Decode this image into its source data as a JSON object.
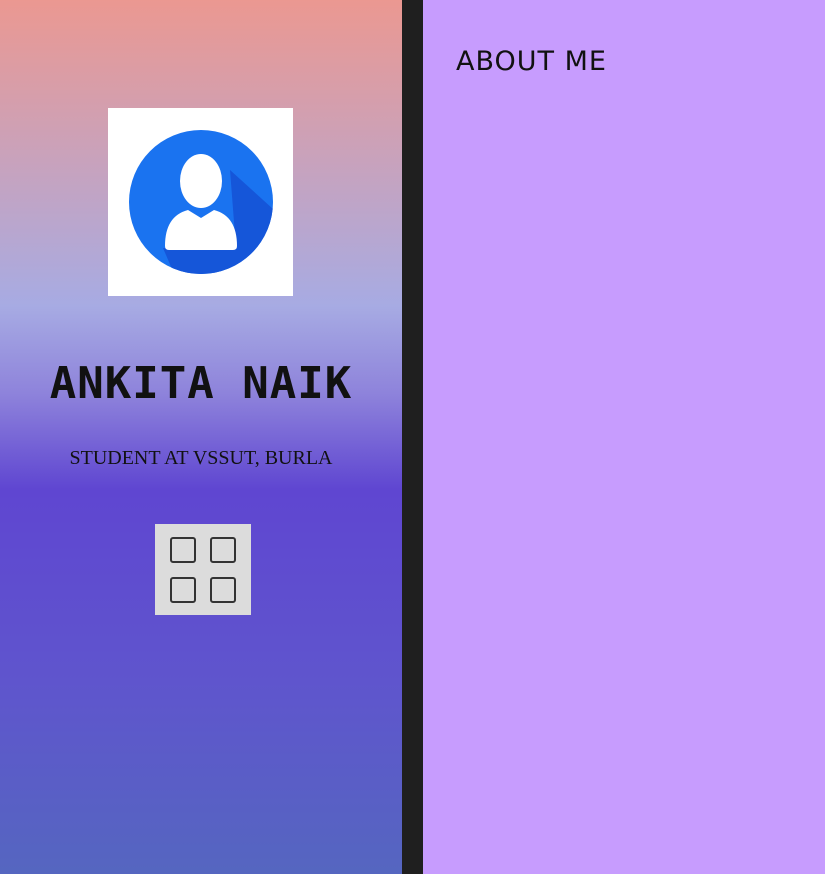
{
  "profile": {
    "name": "ANKITA NAIK",
    "subtitle": "STUDENT AT VSSUT, BURLA",
    "avatar_icon": "user-avatar-icon",
    "menu_icon": "grid-icon"
  },
  "about": {
    "title": "ABOUT ME"
  },
  "colors": {
    "left_gradient_top": "#eb9891",
    "left_gradient_mid": "#5f46d1",
    "left_gradient_bottom": "#5566c0",
    "divider": "#1f1f1f",
    "right_background": "#c79cfe",
    "avatar_blue": "#1a73f0"
  }
}
